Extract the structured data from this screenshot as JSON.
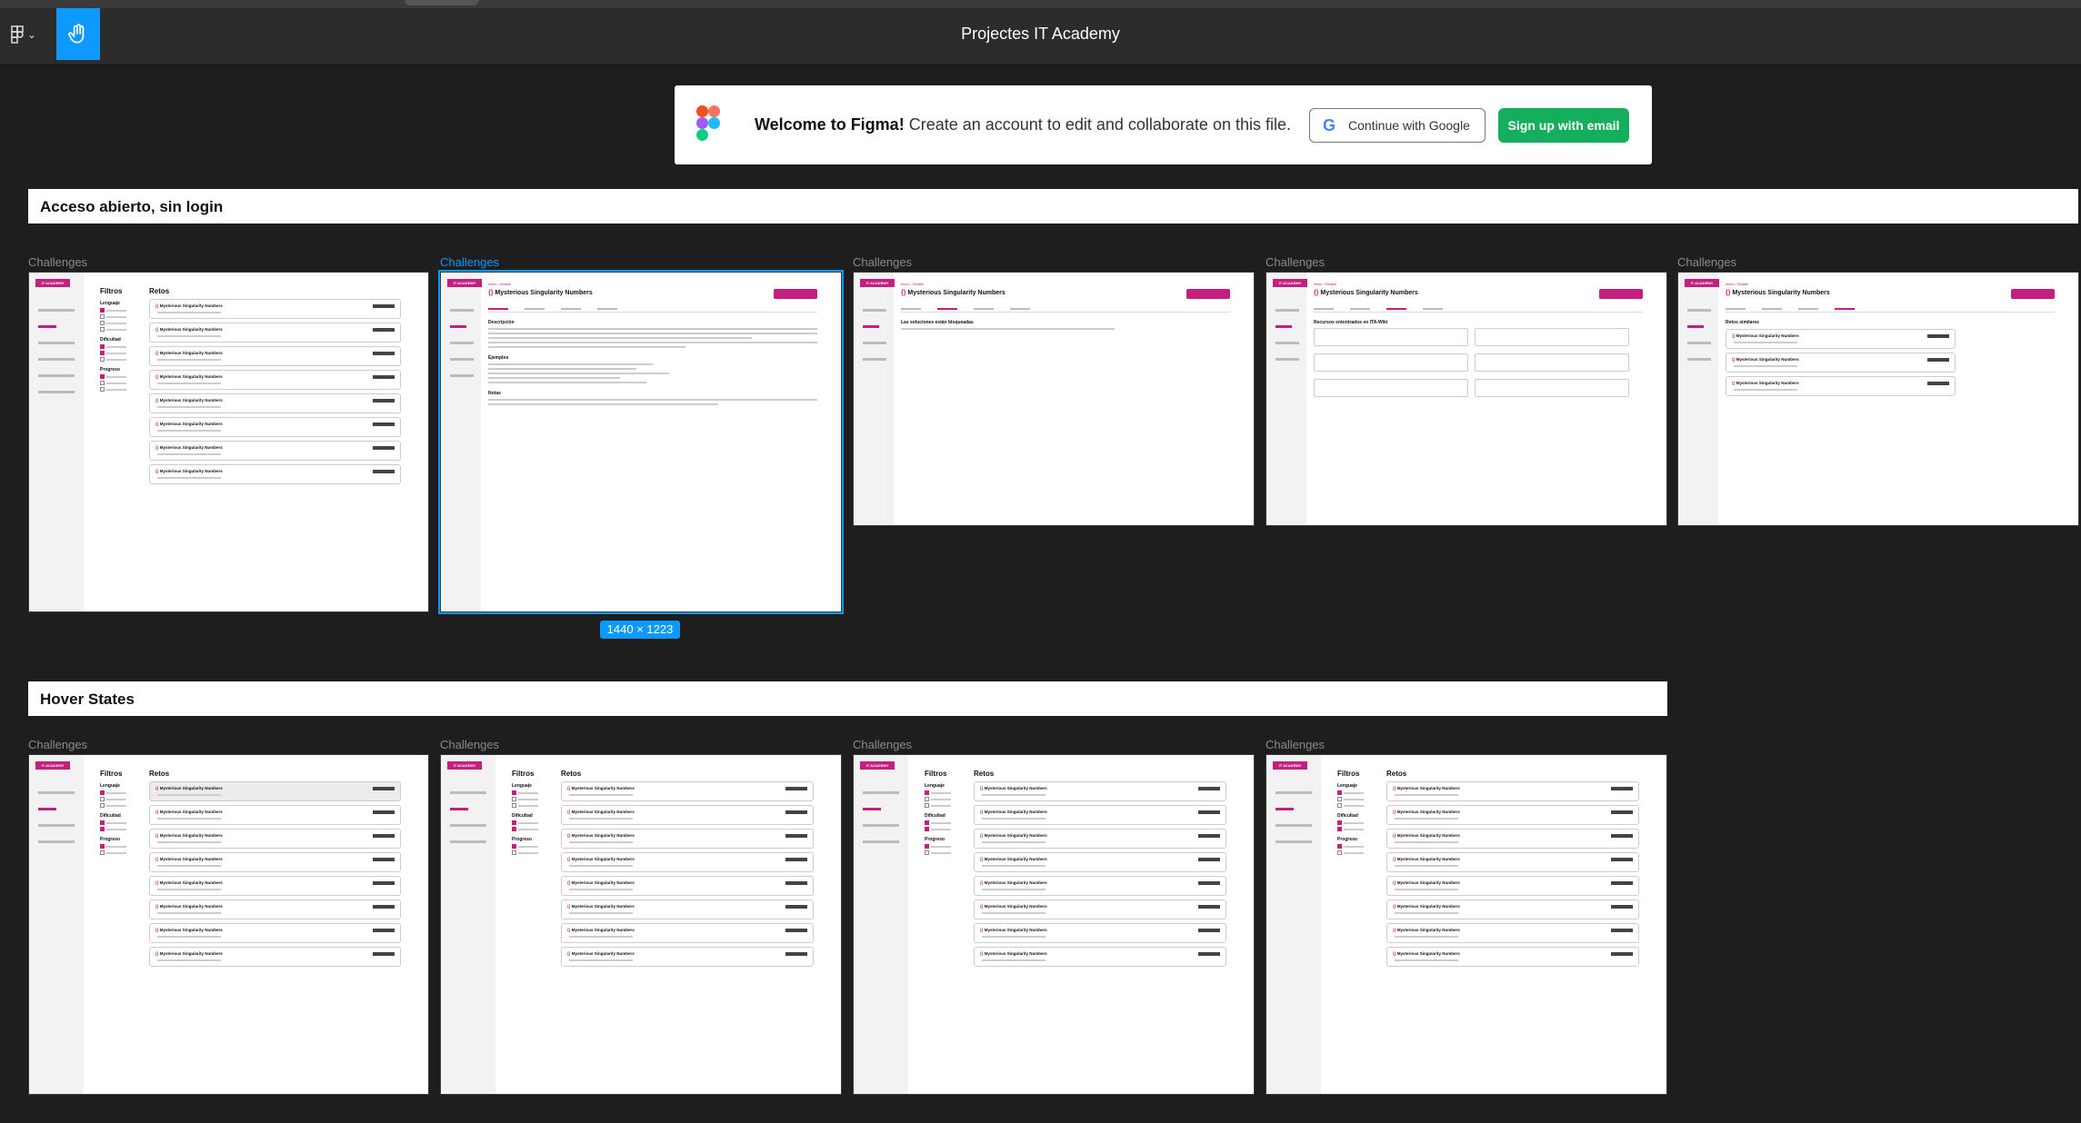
{
  "toolbar": {
    "title": "Projectes IT Academy",
    "menu_icon": "figma-logo-icon",
    "hand_icon": "hand-tool-icon"
  },
  "banner": {
    "welcome_bold": "Welcome to Figma!",
    "welcome_rest": "Create an account to edit and collaborate on this file.",
    "google_label": "Continue with Google",
    "email_label": "Sign up with email"
  },
  "sections": [
    {
      "title": "Acceso abierto, sin login"
    },
    {
      "title": "Hover States"
    }
  ],
  "frames": {
    "label": "Challenges",
    "size_badge": "1440 × 1223"
  },
  "mock": {
    "brand": "IT ACADEMY",
    "filters_title": "Filtros",
    "retos_title": "Retos",
    "challenge_title": "Mysterious Singularity Numbers",
    "descripcion": "Descripción",
    "ejemplos": "Ejemplos",
    "notas": "Notas",
    "bloqueadas": "Las soluciones están bloqueadas",
    "recursos": "Recursos entontrados en ITA-Wiki",
    "similares": "Retos similares"
  },
  "colors": {
    "accent": "#c41e7f",
    "figma_blue": "#0d99ff",
    "signup_green": "#14ae5c"
  }
}
